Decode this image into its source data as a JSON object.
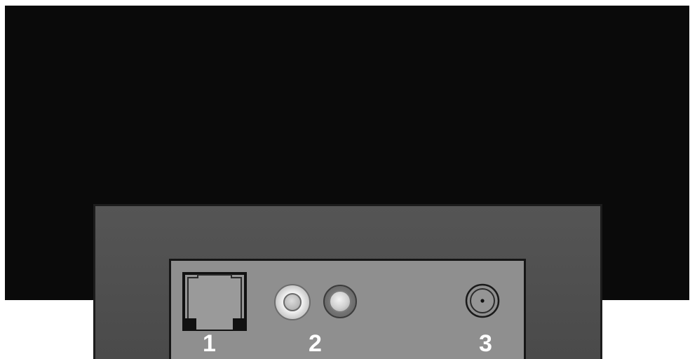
{
  "ports": [
    {
      "number": "1",
      "icon": "rj11-port-icon"
    },
    {
      "number": "2",
      "icon": "rca-jack-pair-icon"
    },
    {
      "number": "3",
      "icon": "coaxial-jack-icon"
    }
  ],
  "colors": {
    "device_body": "#0a0a0a",
    "front_panel": "#4f4f4f",
    "port_plate": "#8f8f8f",
    "label_text": "#ffffff"
  }
}
